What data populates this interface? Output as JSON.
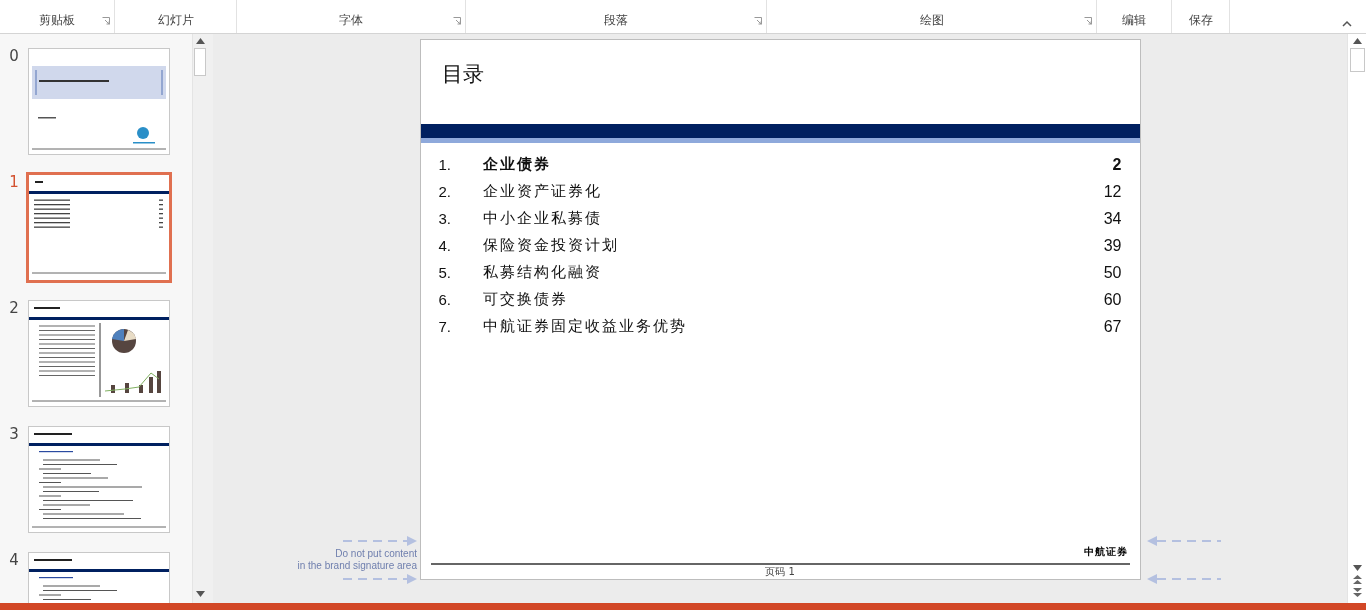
{
  "ribbon": {
    "groups": [
      {
        "label": "剪贴板",
        "launcher": true
      },
      {
        "label": "幻灯片",
        "launcher": false
      },
      {
        "label": "字体",
        "launcher": true
      },
      {
        "label": "段落",
        "launcher": true
      },
      {
        "label": "绘图",
        "launcher": true
      },
      {
        "label": "编辑",
        "launcher": false
      },
      {
        "label": "保存",
        "launcher": false
      }
    ]
  },
  "thumbnails": [
    {
      "number": "0",
      "kind": "title",
      "selected": false
    },
    {
      "number": "1",
      "kind": "toc",
      "selected": true
    },
    {
      "number": "2",
      "kind": "chart",
      "selected": false
    },
    {
      "number": "3",
      "kind": "text",
      "selected": false
    },
    {
      "number": "4",
      "kind": "text",
      "selected": false
    }
  ],
  "slide": {
    "title": "目录",
    "toc": [
      {
        "number": "1.",
        "text": "企业债券",
        "page": "2",
        "bold": true
      },
      {
        "number": "2.",
        "text": "企业资产证券化",
        "page": "12",
        "bold": false
      },
      {
        "number": "3.",
        "text": "中小企业私募债",
        "page": "34",
        "bold": false
      },
      {
        "number": "4.",
        "text": "保险资金投资计划",
        "page": "39",
        "bold": false
      },
      {
        "number": "5.",
        "text": "私募结构化融资",
        "page": "50",
        "bold": false
      },
      {
        "number": "6.",
        "text": "可交换债券",
        "page": "60",
        "bold": false
      },
      {
        "number": "7.",
        "text": "中航证券固定收益业务优势",
        "page": "67",
        "bold": false
      }
    ],
    "brand": "中航证券",
    "page_label": "页码 1"
  },
  "signature_note": {
    "lines": [
      "Do not put content",
      "in the brand signature area"
    ]
  }
}
